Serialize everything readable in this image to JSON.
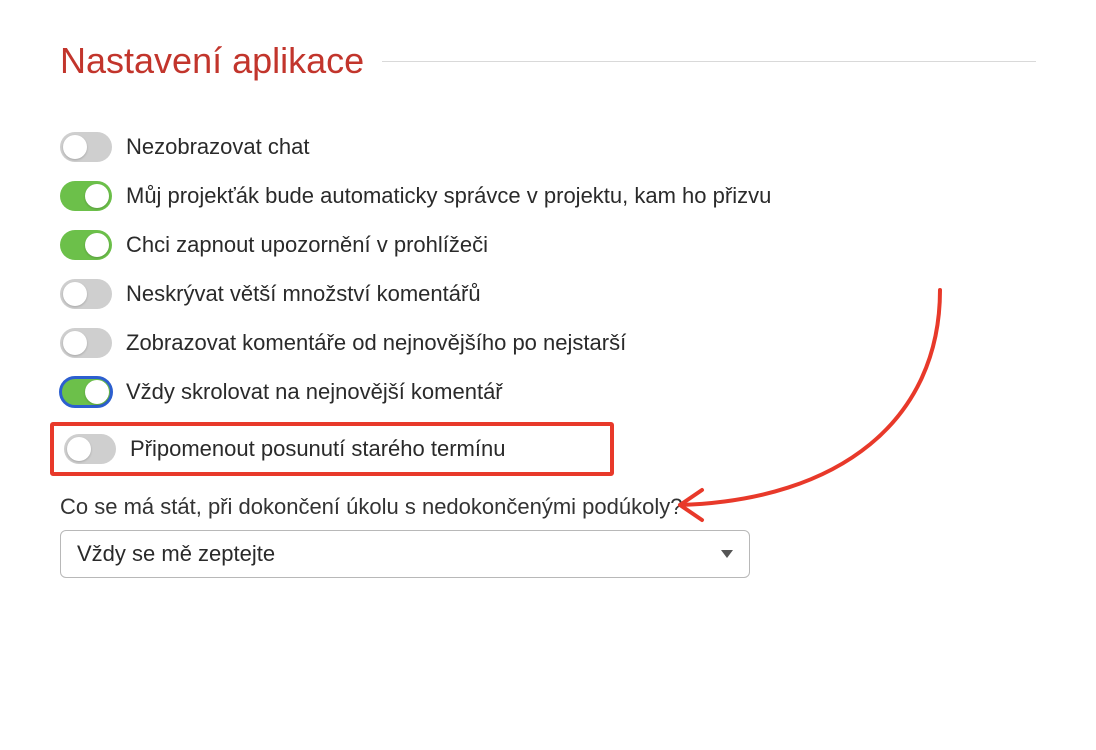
{
  "title": "Nastavení aplikace",
  "settings": [
    {
      "label": "Nezobrazovat chat",
      "state": "off",
      "focused": false
    },
    {
      "label": "Můj projekťák bude automaticky správce v projektu, kam ho přizvu",
      "state": "on",
      "focused": false
    },
    {
      "label": "Chci zapnout upozornění v prohlížeči",
      "state": "on",
      "focused": false
    },
    {
      "label": "Neskrývat větší množství komentářů",
      "state": "off",
      "focused": false
    },
    {
      "label": "Zobrazovat komentáře od nejnovějšího po nejstarší",
      "state": "off",
      "focused": false
    },
    {
      "label": "Vždy skrolovat na nejnovější komentář",
      "state": "on",
      "focused": true
    },
    {
      "label": "Připomenout posunutí starého termínu",
      "state": "off",
      "focused": false,
      "highlighted": true
    }
  ],
  "question": {
    "label": "Co se má stát, při dokončení úkolu s nedokončenými podúkoly?",
    "selected": "Vždy se mě zeptejte"
  },
  "colors": {
    "accent": "#c2352c",
    "toggleOn": "#6cc04a",
    "toggleOff": "#cfcfcf",
    "highlight": "#e8392a",
    "focusRing": "#2c5fcf"
  }
}
